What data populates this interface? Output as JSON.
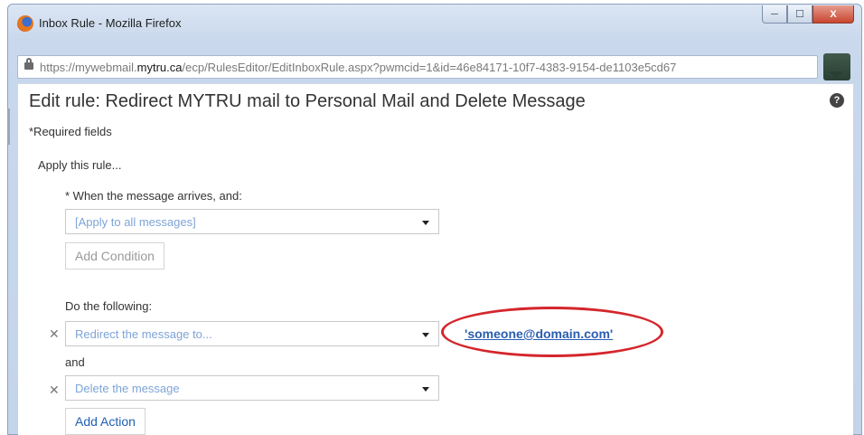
{
  "window": {
    "title": "Inbox Rule - Mozilla Firefox",
    "controls": {
      "minimize": "─",
      "maximize": "☐",
      "close": "X"
    }
  },
  "urlbar": {
    "prefix": "https://mywebmail.",
    "domain": "mytru.ca",
    "path": "/ecp/RulesEditor/EditInboxRule.aspx?pwmcid=1&id=46e84171-10f7-4383-9154-de1103e5cd67"
  },
  "page": {
    "title": "Edit rule: Redirect MYTRU mail to Personal Mail and Delete Message",
    "help": "?",
    "required_note": "*Required fields",
    "apply_label": "Apply this rule...",
    "when_label": "* When the message arrives, and:",
    "condition_select": "[Apply to all messages]",
    "add_condition": "Add Condition",
    "do_following": "Do the following:",
    "actions": [
      {
        "remove": "✕",
        "value": "Redirect the message to..."
      },
      {
        "remove": "✕",
        "value": "Delete the message"
      }
    ],
    "and_label": "and",
    "redirect_recipient": "'someone@domain.com'",
    "add_action": "Add Action"
  },
  "colors": {
    "annotation": "#d4262c",
    "link": "#2a5db0",
    "select_text": "#7ea4d6"
  }
}
